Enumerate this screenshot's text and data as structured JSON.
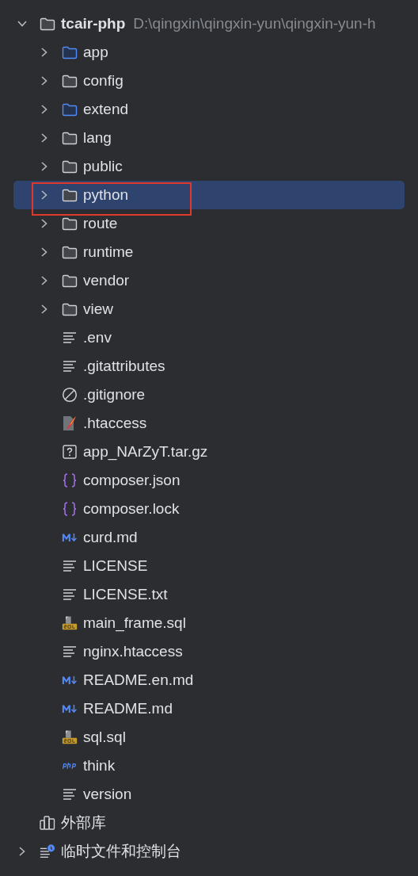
{
  "tree": [
    {
      "label": "tcair-php",
      "path": "D:\\qingxin\\qingxin-yun\\qingxin-yun-h",
      "kind": "folder",
      "expanded": true,
      "selected": false,
      "highlighted": false,
      "children": [
        {
          "label": "app",
          "kind": "source-folder",
          "expanded": false,
          "selected": false,
          "highlighted": false
        },
        {
          "label": "config",
          "kind": "folder",
          "expanded": false,
          "selected": false,
          "highlighted": false
        },
        {
          "label": "extend",
          "kind": "source-folder",
          "expanded": false,
          "selected": false,
          "highlighted": false
        },
        {
          "label": "lang",
          "kind": "folder",
          "expanded": false,
          "selected": false,
          "highlighted": false
        },
        {
          "label": "public",
          "kind": "folder",
          "expanded": false,
          "selected": false,
          "highlighted": false
        },
        {
          "label": "python",
          "kind": "folder",
          "expanded": false,
          "selected": true,
          "highlighted": true
        },
        {
          "label": "route",
          "kind": "folder",
          "expanded": false,
          "selected": false,
          "highlighted": false
        },
        {
          "label": "runtime",
          "kind": "folder",
          "expanded": false,
          "selected": false,
          "highlighted": false
        },
        {
          "label": "vendor",
          "kind": "folder",
          "expanded": false,
          "selected": false,
          "highlighted": false
        },
        {
          "label": "view",
          "kind": "folder",
          "expanded": false,
          "selected": false,
          "highlighted": false
        },
        {
          "label": ".env",
          "kind": "text",
          "selected": false,
          "highlighted": false
        },
        {
          "label": ".gitattributes",
          "kind": "text",
          "selected": false,
          "highlighted": false
        },
        {
          "label": ".gitignore",
          "kind": "ignore",
          "selected": false,
          "highlighted": false
        },
        {
          "label": ".htaccess",
          "kind": "htaccess",
          "selected": false,
          "highlighted": false
        },
        {
          "label": "app_NArZyT.tar.gz",
          "kind": "unknown",
          "selected": false,
          "highlighted": false
        },
        {
          "label": "composer.json",
          "kind": "json",
          "selected": false,
          "highlighted": false
        },
        {
          "label": "composer.lock",
          "kind": "json",
          "selected": false,
          "highlighted": false
        },
        {
          "label": "curd.md",
          "kind": "markdown",
          "selected": false,
          "highlighted": false
        },
        {
          "label": "LICENSE",
          "kind": "text",
          "selected": false,
          "highlighted": false
        },
        {
          "label": "LICENSE.txt",
          "kind": "text",
          "selected": false,
          "highlighted": false
        },
        {
          "label": "main_frame.sql",
          "kind": "sql",
          "selected": false,
          "highlighted": false
        },
        {
          "label": "nginx.htaccess",
          "kind": "text",
          "selected": false,
          "highlighted": false
        },
        {
          "label": "README.en.md",
          "kind": "markdown",
          "selected": false,
          "highlighted": false
        },
        {
          "label": "README.md",
          "kind": "markdown",
          "selected": false,
          "highlighted": false
        },
        {
          "label": "sql.sql",
          "kind": "sql",
          "selected": false,
          "highlighted": false
        },
        {
          "label": "think",
          "kind": "php",
          "selected": false,
          "highlighted": false
        },
        {
          "label": "version",
          "kind": "text",
          "selected": false,
          "highlighted": false
        }
      ]
    },
    {
      "label": "外部库",
      "kind": "library",
      "selected": false,
      "highlighted": false
    },
    {
      "label": "临时文件和控制台",
      "kind": "scratches",
      "expanded": false,
      "selected": false,
      "highlighted": false
    }
  ]
}
